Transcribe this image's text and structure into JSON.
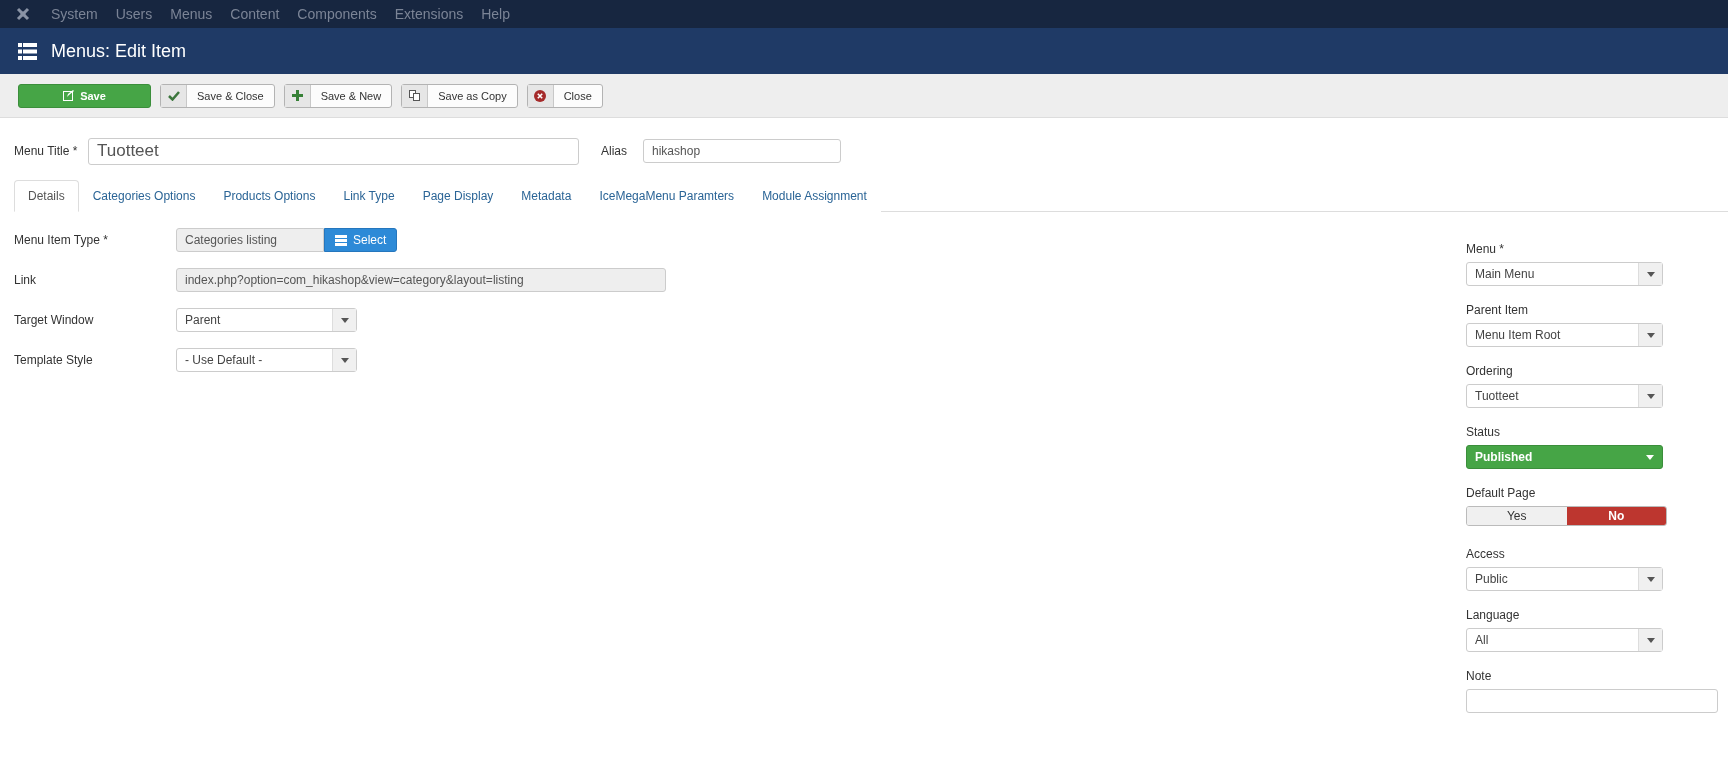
{
  "top_menu": [
    "System",
    "Users",
    "Menus",
    "Content",
    "Components",
    "Extensions",
    "Help"
  ],
  "header": {
    "title": "Menus: Edit Item"
  },
  "toolbar": [
    {
      "kind": "primary",
      "label": "Save"
    },
    {
      "kind": "check",
      "label": "Save & Close"
    },
    {
      "kind": "plus",
      "label": "Save & New"
    },
    {
      "kind": "copy",
      "label": "Save as Copy"
    },
    {
      "kind": "close",
      "label": "Close"
    }
  ],
  "title_row": {
    "title_label": "Menu Title *",
    "title_value": "Tuotteet",
    "alias_label": "Alias",
    "alias_value": "hikashop"
  },
  "tabs": [
    {
      "label": "Details",
      "selected": true
    },
    {
      "label": "Categories Options",
      "selected": false
    },
    {
      "label": "Products Options",
      "selected": false
    },
    {
      "label": "Link Type",
      "selected": false
    },
    {
      "label": "Page Display",
      "selected": false
    },
    {
      "label": "Metadata",
      "selected": false
    },
    {
      "label": "IceMegaMenu Paramters",
      "selected": false
    },
    {
      "label": "Module Assignment",
      "selected": false
    }
  ],
  "left_fields": [
    {
      "kind": "type",
      "label": "Menu Item Type *",
      "value": "Categories listing",
      "button": "Select"
    },
    {
      "kind": "readonly",
      "label": "Link",
      "value": "index.php?option=com_hikashop&view=category&layout=listing"
    },
    {
      "kind": "select",
      "label": "Target Window",
      "value": "Parent"
    },
    {
      "kind": "select",
      "label": "Template Style",
      "value": "- Use Default -"
    }
  ],
  "right_fields": [
    {
      "kind": "select",
      "label": "Menu *",
      "value": "Main Menu"
    },
    {
      "kind": "select",
      "label": "Parent Item",
      "value": "Menu Item Root"
    },
    {
      "kind": "select",
      "label": "Ordering",
      "value": "Tuotteet"
    },
    {
      "kind": "status",
      "label": "Status",
      "value": "Published"
    },
    {
      "kind": "toggle",
      "label": "Default Page",
      "options": [
        {
          "label": "Yes",
          "selected": false
        },
        {
          "label": "No",
          "selected": true
        }
      ]
    },
    {
      "kind": "select",
      "label": "Access",
      "value": "Public"
    },
    {
      "kind": "select",
      "label": "Language",
      "value": "All"
    },
    {
      "kind": "text",
      "label": "Note"
    }
  ]
}
